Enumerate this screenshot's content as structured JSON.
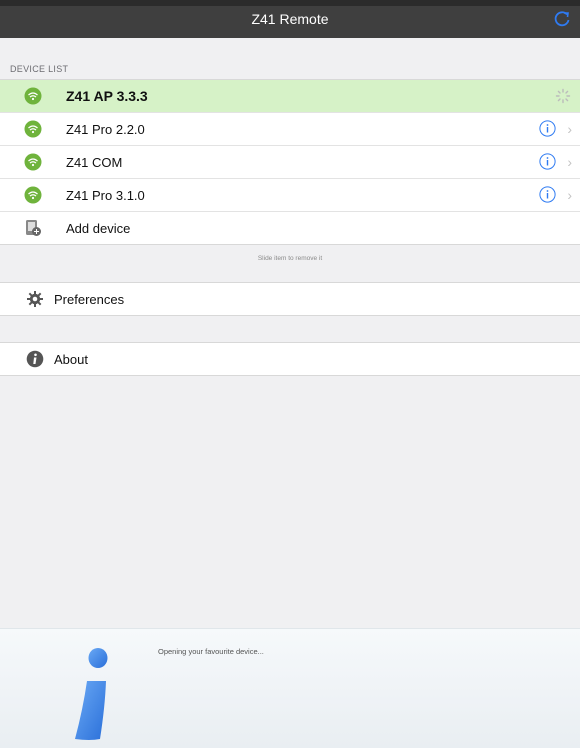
{
  "nav": {
    "title": "Z41 Remote",
    "refresh_icon": "refresh-icon"
  },
  "device_list": {
    "header": "DEVICE LIST",
    "items": [
      {
        "label": "Z41 AP 3.3.3",
        "selected": true,
        "status": "loading"
      },
      {
        "label": "Z41 Pro 2.2.0"
      },
      {
        "label": "Z41 COM"
      },
      {
        "label": "Z41 Pro 3.1.0"
      }
    ],
    "add_label": "Add device",
    "hint": "Slide item to remove it"
  },
  "preferences": {
    "label": "Preferences"
  },
  "about": {
    "label": "About"
  },
  "footer": {
    "message": "Opening your favourite device..."
  },
  "colors": {
    "selected_row": "#d6f2c7",
    "accent": "#2f7bf2",
    "device_icon": "#6fb33c"
  }
}
